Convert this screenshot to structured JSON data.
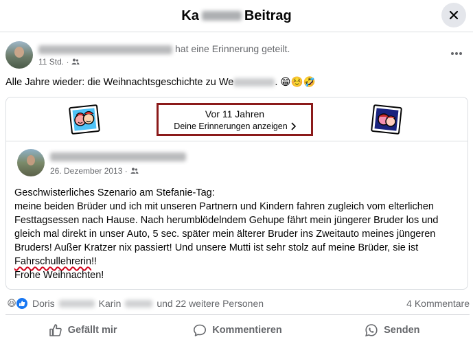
{
  "header": {
    "title_prefix": "Ka",
    "title_suffix": "Beitrag"
  },
  "post": {
    "action_text": "hat eine Erinnerung geteilt.",
    "time": "11 Std. ·",
    "text_before": "Alle Jahre wieder: die Weihnachtsgeschichte zu We",
    "text_after": ". 😁☺️🤣"
  },
  "memory": {
    "title": "Vor 11 Jahren",
    "link_label": "Deine Erinnerungen anzeigen",
    "inner_date": "26. Dezember 2013 ·",
    "lines": [
      "Geschwisterliches Szenario am Stefanie-Tag:",
      "meine beiden Brüder und ich mit unseren Partnern und Kindern fahren zugleich vom elterlichen",
      "Festtagsessen nach Hause. Nach herumblödelndem Gehupe fährt mein jüngerer Bruder los und",
      "gleich mal direkt in unser Auto, 5 sec. später mein älterer Bruder ins Zweitauto meines jüngeren",
      "Bruders! Außer Kratzer nix passiert! Und unsere Mutti ist sehr stolz auf meine Brüder, sie ist"
    ],
    "underlined_word": "Fahrschullehrerin",
    "after_underlined": "!!",
    "last_line": "Frohe Weihnachten!"
  },
  "reactions": {
    "name1": "Doris",
    "name2": "Karin",
    "others": "und 22 weitere Personen",
    "comments": "4 Kommentare"
  },
  "actions": {
    "like": "Gefällt mir",
    "comment": "Kommentieren",
    "send": "Senden"
  },
  "colors": {
    "highlight_border": "#8b1a1a",
    "like_blue": "#1877f2",
    "squiggle_red": "#d0021b"
  }
}
